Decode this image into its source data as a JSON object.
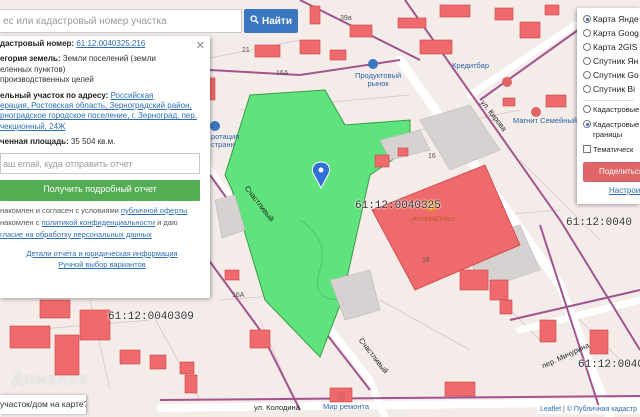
{
  "search": {
    "placeholder": "ес или кадастровый номер участка",
    "button_label": "Найти"
  },
  "panel": {
    "cadastral_label": "дастровый номер:",
    "cadastral_value": "61:12:0040325:216",
    "category_label": "егория земель:",
    "category_value": "Земли поселений (земли",
    "category_line2": "еленных пунктов)",
    "use_line": "производственных целей",
    "address_label": "ельный участок по адресу:",
    "address_link_1": "Российская",
    "address_link_2": "ерация, Ростовская область, Зерноградский район,",
    "address_link_3": "рноградское городское поселение, г. Зерноград, пер.",
    "address_link_4": "чекционный, 24Ж",
    "area_label": "ченная площадь:",
    "area_value": "35 504 кв.м.",
    "email_placeholder": "аш email, куда отправить отчет",
    "report_button": "Получить подробный отчет",
    "agree_1_pre": "накомлен и согласен с условиями",
    "agree_1_link": "публичной оферты",
    "agree_2_pre": "накомлен с",
    "agree_2_link": "политикой конфиденциальности",
    "agree_2_post": "и даю",
    "agree_3": "гласие на обработку персональных данных",
    "details_link": "Детали отчета и юридическая информация",
    "manual_link": "Ручной выбор вариантов"
  },
  "layers": {
    "base_options": [
      "Карта Янде",
      "Карта Goog",
      "Карта 2GIS",
      "Спутник Ян",
      "Спутник Go",
      "Спутник Bi"
    ],
    "selected_index": 0,
    "overlay_1": [
      "Кадастровые",
      ""
    ],
    "overlay_2": [
      "Кадастровые",
      "границы"
    ],
    "overlay_3": [
      "Тематическ",
      ""
    ],
    "share_label": "Поделиться",
    "configure_label": "Настроит"
  },
  "map": {
    "cadastral_labels": [
      "61:12:0040325",
      "61:12:0040309",
      "61:12:0040",
      "61:12:0040"
    ],
    "poi": [
      "Продуктовый\nрынок",
      "Магнит Семейный",
      "АптекаПлюс",
      "Мир ремонта",
      "Кредитбар",
      "ротация\nстрани"
    ],
    "numbers": [
      "21",
      "16А",
      "16",
      "16",
      "39а",
      "16А",
      "4"
    ],
    "streets": [
      "ул. Колодина",
      "пер. Мичурина",
      "ул. Кирова",
      "Счастливый"
    ],
    "watermark": "Домклик",
    "question": "участок/дом на карте?",
    "attribution_leaflet": "Leaflet",
    "attribution_map": "© Публичная кадастр"
  },
  "colors": {
    "parcel_green": "#5fe37d",
    "building_red": "#ee6a6c",
    "boundary": "#a2548e",
    "button_blue": "#3b76c0",
    "button_green": "#53ad52",
    "share_red": "#e06566"
  }
}
